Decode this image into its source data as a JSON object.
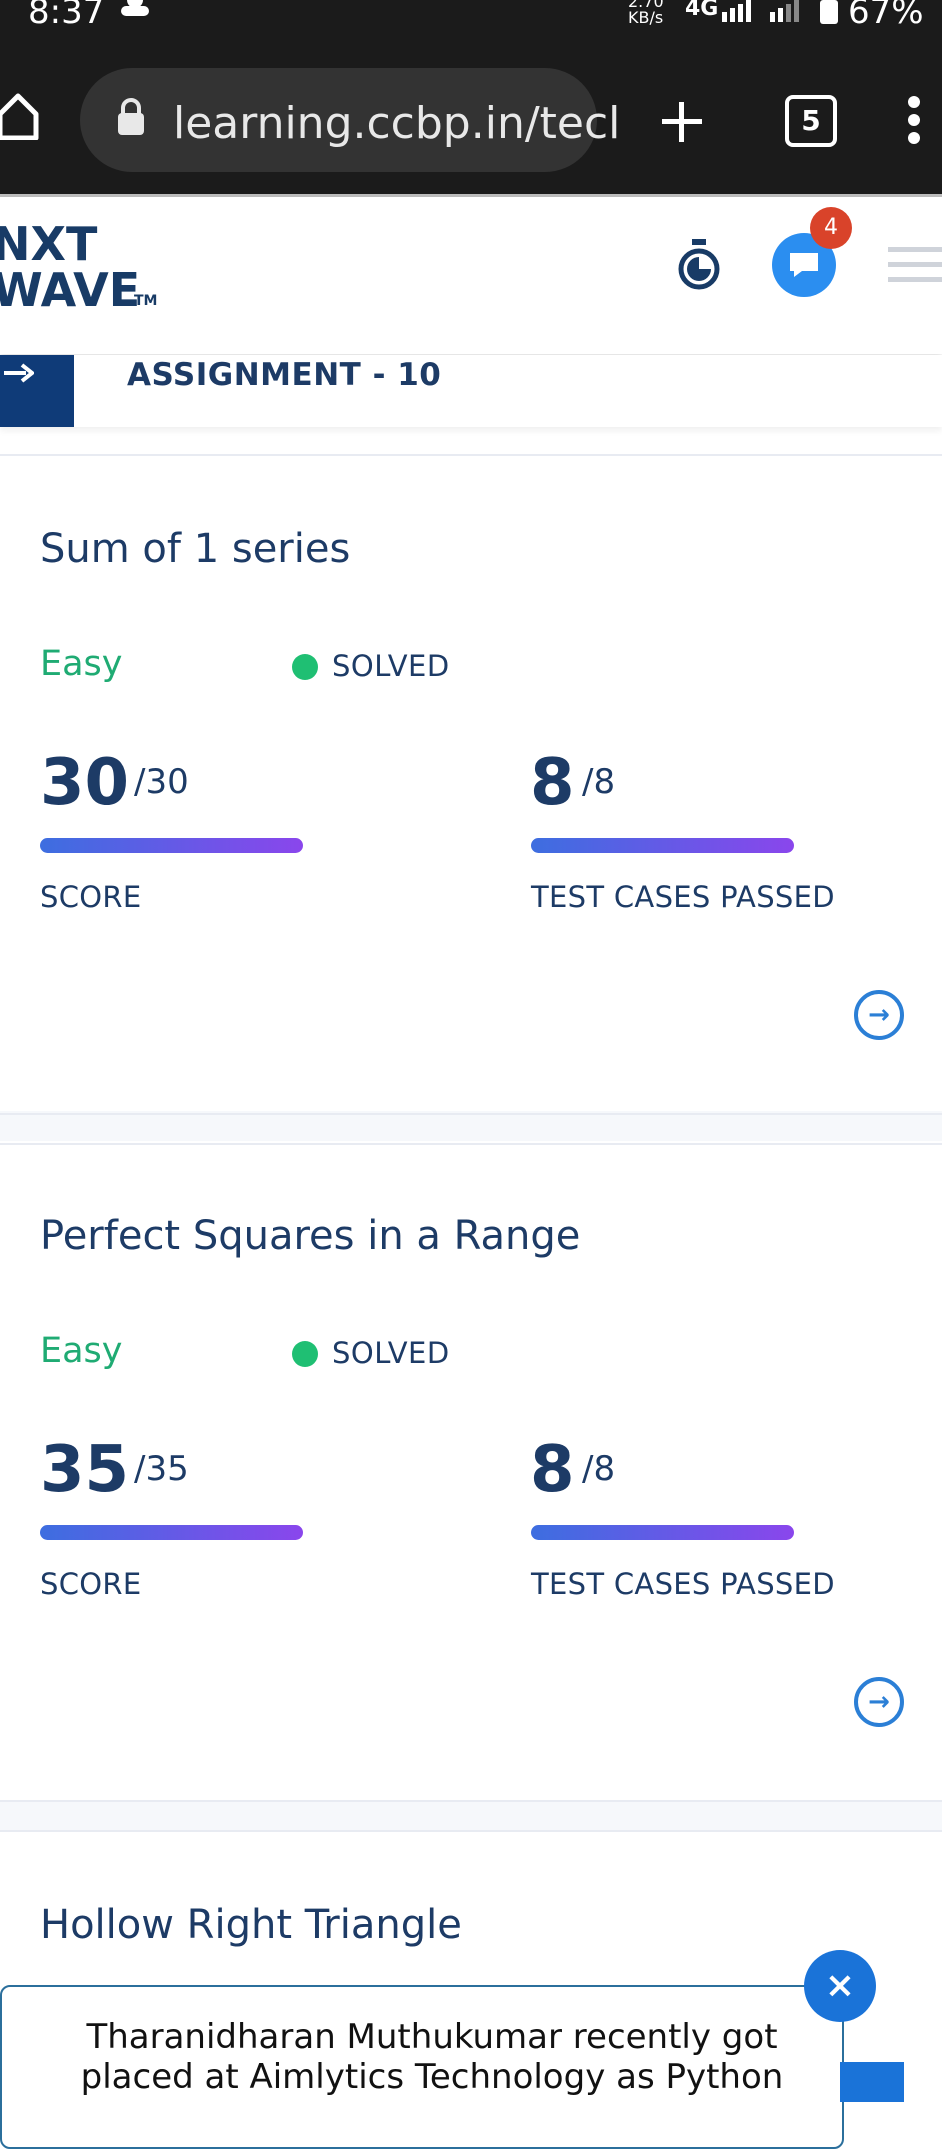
{
  "status": {
    "time": "8:37",
    "speed": "2.70\nKB/s",
    "network": "4G",
    "battery": "67%"
  },
  "browser": {
    "url": "learning.ccbp.in/tecl",
    "tabs_count": "5"
  },
  "header": {
    "logo_line1": "NXT",
    "logo_line2": "WAVE",
    "logo_tm": "TM",
    "notification_count": "4"
  },
  "assignment": {
    "title": "ASSIGNMENT - 10"
  },
  "questions": [
    {
      "title": "Sum of 1 series",
      "difficulty": "Easy",
      "status": "SOLVED",
      "score": "30",
      "score_total": "/30",
      "score_label": "SCORE",
      "tests": "8",
      "tests_total": "/8",
      "tests_label": "TEST CASES PASSED"
    },
    {
      "title": "Perfect Squares in a Range",
      "difficulty": "Easy",
      "status": "SOLVED",
      "score": "35",
      "score_total": "/35",
      "score_label": "SCORE",
      "tests": "8",
      "tests_total": "/8",
      "tests_label": "TEST CASES PASSED"
    },
    {
      "title": "Hollow Right Triangle"
    }
  ],
  "toast": {
    "message": "Tharanidharan Muthukumar recently got placed at Aimlytics Technology as Python",
    "close_symbol": "×"
  },
  "colors": {
    "primary": "#1d3b66",
    "success": "#1fab73",
    "accent": "#2b8ef0",
    "badge": "#d9432a"
  }
}
